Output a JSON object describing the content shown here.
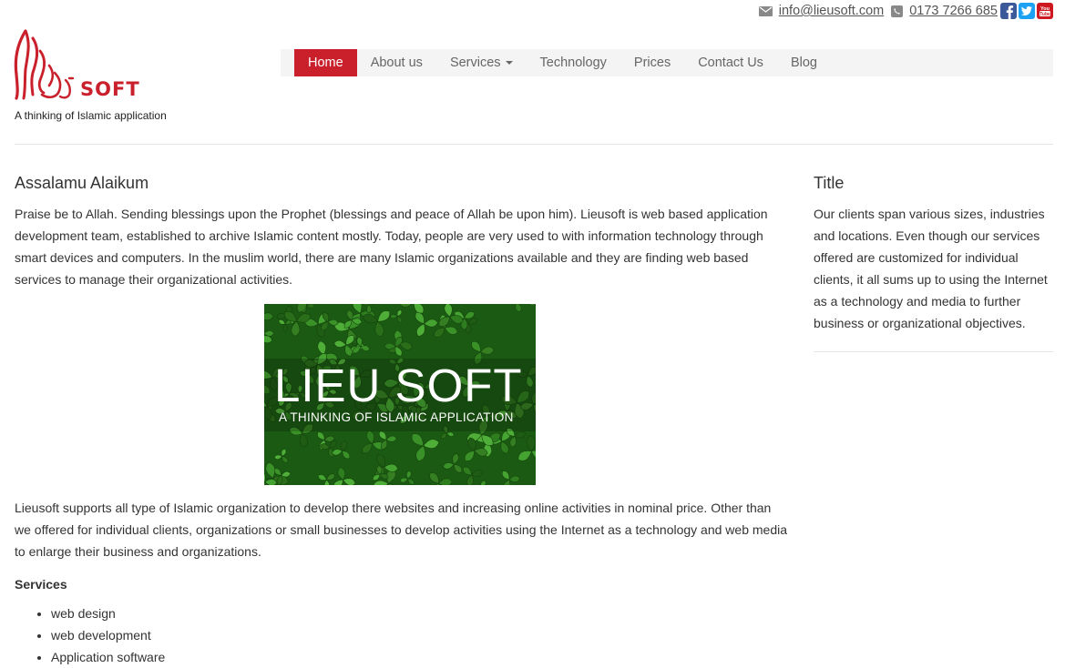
{
  "contact": {
    "email": "info@lieusoft.com",
    "phone": "0173 7266 685",
    "icons": [
      "envelope-icon",
      "phone-icon",
      "facebook-icon",
      "twitter-icon",
      "youtube-icon"
    ],
    "youtube_text": "You Tube"
  },
  "brand": {
    "logo_text": "SOFT",
    "tagline": "A thinking of Islamic application",
    "color": "#c9202c"
  },
  "nav": {
    "items": [
      {
        "label": "Home",
        "active": true
      },
      {
        "label": "About us"
      },
      {
        "label": "Services",
        "has_dropdown": true
      },
      {
        "label": "Technology"
      },
      {
        "label": "Prices"
      },
      {
        "label": "Contact Us"
      },
      {
        "label": "Blog"
      }
    ]
  },
  "main": {
    "heading": "Assalamu Alaikum",
    "intro": "Praise be to Allah. Sending blessings upon the Prophet (blessings and peace of Allah be upon him). Lieusoft is web based application development team, established to archive Islamic content mostly. Today, people are very used to with information technology through smart devices and computers. In the muslim world, there are many Islamic organizations available and they are finding web based services to manage their organizational activities.",
    "hero": {
      "title": "LIEU SOFT",
      "subtitle": "A THINKING OF ISLAMIC APPLICATION"
    },
    "body": "Lieusoft supports all type of Islamic organization to develop there websites and increasing online activities in nominal price. Other than we offered for individual clients, organizations  or small businesses to develop activities using the Internet as a technology and web media to enlarge their business and organizations.",
    "services_title": "Services",
    "services": [
      "web design",
      "web development",
      "Application software"
    ]
  },
  "sidebar": {
    "title": "Title",
    "text": "Our clients span various sizes, industries and locations. Even though our services offered are customized for individual clients, it all sums up to using the Internet as a technology and media to further business or organizational objectives."
  }
}
